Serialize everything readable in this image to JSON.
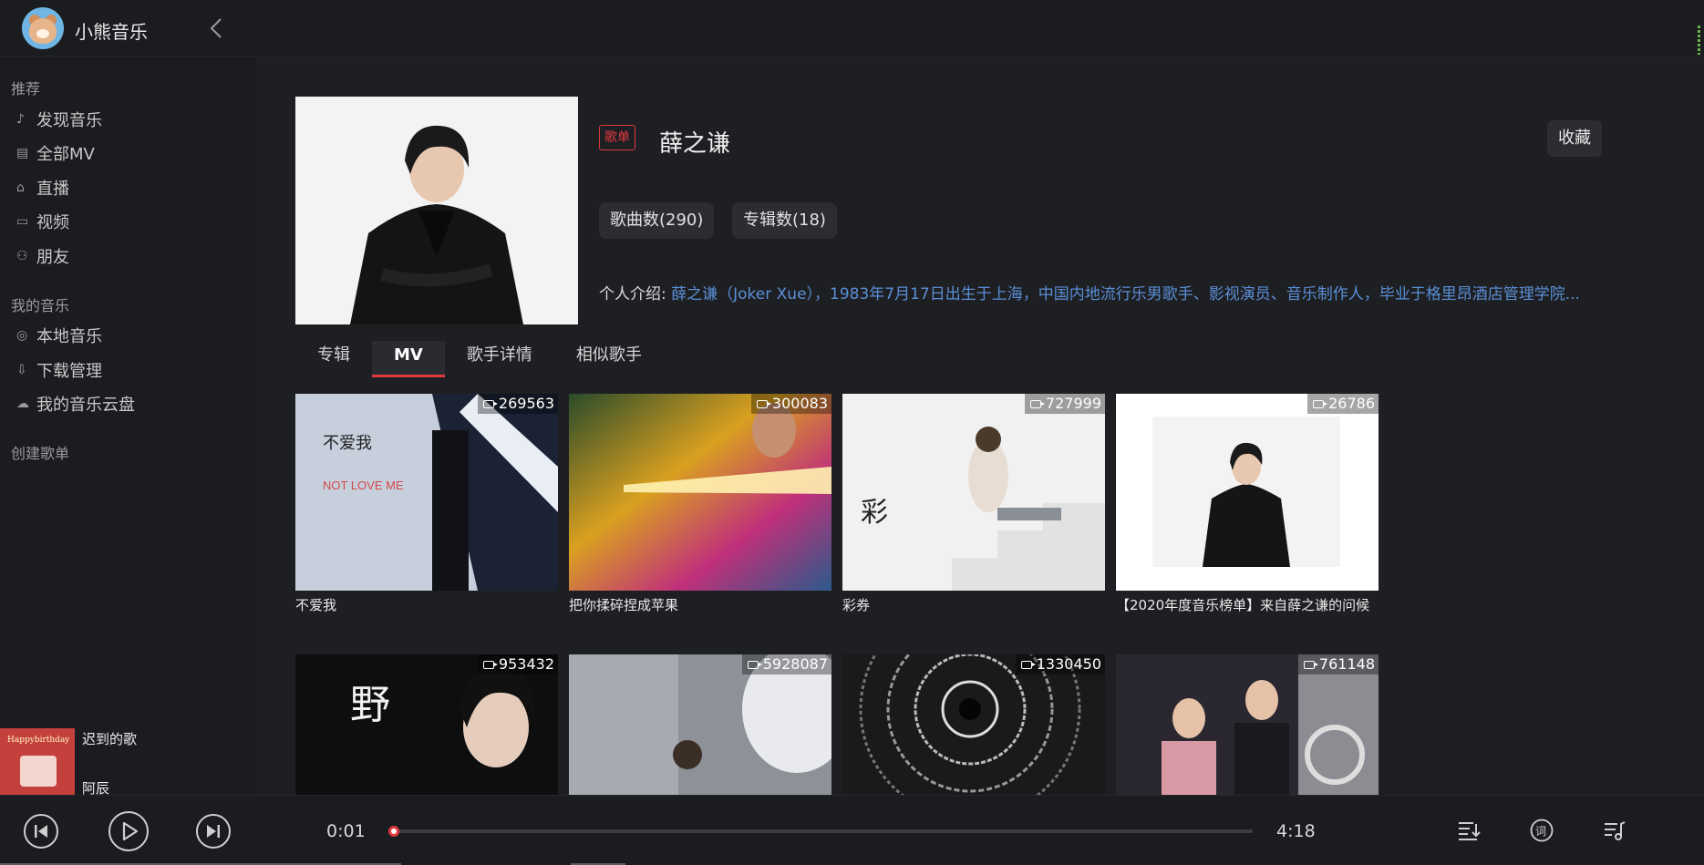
{
  "app": {
    "title": "小熊音乐"
  },
  "sidebar": {
    "sections": [
      "推荐",
      "我的音乐",
      "创建歌单"
    ],
    "recommend": [
      {
        "label": "发现音乐",
        "icon": "music-note-icon"
      },
      {
        "label": "全部MV",
        "icon": "document-icon"
      },
      {
        "label": "直播",
        "icon": "live-tv-icon"
      },
      {
        "label": "视频",
        "icon": "video-camera-icon"
      },
      {
        "label": "朋友",
        "icon": "friends-icon"
      }
    ],
    "my_music": [
      {
        "label": "本地音乐",
        "icon": "local-music-icon"
      },
      {
        "label": "下载管理",
        "icon": "download-icon"
      },
      {
        "label": "我的音乐云盘",
        "icon": "cloud-icon"
      }
    ]
  },
  "now_playing": {
    "song": "迟到的歌",
    "artist": "阿辰",
    "cover_text": "Happybirthday"
  },
  "artist": {
    "tag": "歌单",
    "name": "薛之谦",
    "favorite_label": "收藏",
    "song_count": "歌曲数(290)",
    "album_count": "专辑数(18)",
    "bio_label": "个人介绍:",
    "bio_text": "薛之谦（Joker Xue），1983年7月17日出生于上海，中国内地流行乐男歌手、影视演员、音乐制作人，毕业于格里昂酒店管理学院..."
  },
  "tabs": [
    {
      "label": "专辑",
      "active": false
    },
    {
      "label": "MV",
      "active": true
    },
    {
      "label": "歌手详情",
      "active": false
    },
    {
      "label": "相似歌手",
      "active": false
    }
  ],
  "mvs": [
    {
      "title": "不爱我",
      "count": "269563"
    },
    {
      "title": "把你揉碎捏成苹果",
      "count": "300083"
    },
    {
      "title": "彩券",
      "count": "727999"
    },
    {
      "title": "【2020年度音乐榜单】来自薛之谦的问候",
      "count": "26786"
    },
    {
      "title": "",
      "count": "953432"
    },
    {
      "title": "",
      "count": "5928087"
    },
    {
      "title": "",
      "count": "1330450"
    },
    {
      "title": "",
      "count": "761148"
    }
  ],
  "player": {
    "current_time": "0:01",
    "total_time": "4:18",
    "progress": 0.004
  },
  "colors": {
    "accent": "#e0393e",
    "link": "#5a8fd6",
    "background": "#1e1f23"
  }
}
